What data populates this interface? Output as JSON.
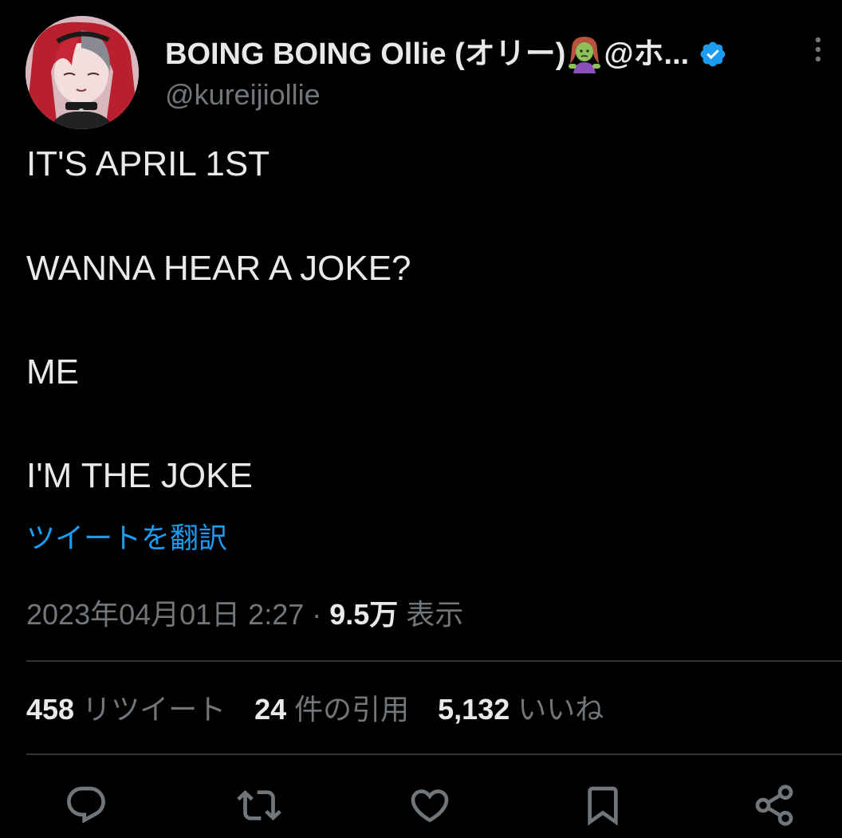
{
  "tweet": {
    "author": {
      "display_name": "BOING BOING Ollie (オリー)",
      "name_suffix": "@ホ...",
      "handle": "@kureijiollie",
      "verified": true
    },
    "text_lines": [
      "IT'S APRIL 1ST",
      "WANNA HEAR A JOKE?",
      "ME",
      "I'M THE JOKE"
    ],
    "translate_label": "ツイートを翻訳",
    "timestamp": "2023年04月01日 2:27",
    "separator": " · ",
    "views_count": "9.5万",
    "views_label": " 表示",
    "stats": {
      "retweets_count": "458",
      "retweets_label": " リツイート",
      "quotes_count": "24",
      "quotes_label": " 件の引用",
      "likes_count": "5,132",
      "likes_label": " いいね"
    }
  },
  "icons": {
    "verified": "verified-badge-icon",
    "zombie": "zombie-emoji-icon",
    "more": "more-vertical-icon",
    "reply": "reply-icon",
    "retweet": "retweet-icon",
    "like": "heart-icon",
    "bookmark": "bookmark-icon",
    "share": "share-icon"
  },
  "colors": {
    "background": "#000000",
    "text_primary": "#e7e9ea",
    "text_secondary": "#71767b",
    "accent": "#1d9bf0",
    "divider": "#2f3336"
  }
}
